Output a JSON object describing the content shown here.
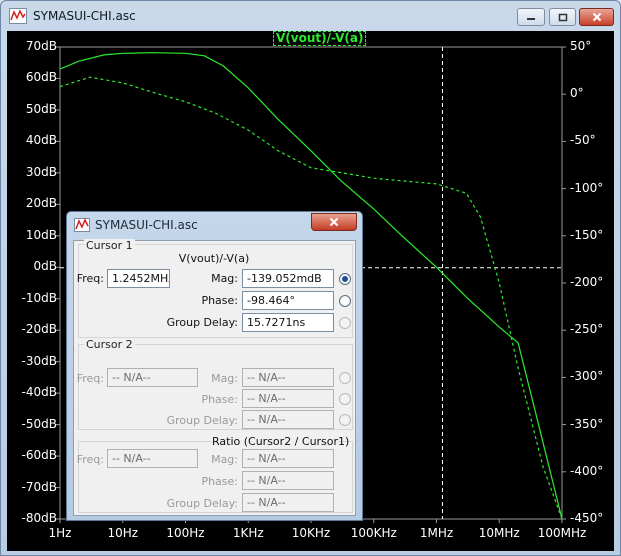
{
  "window": {
    "title": "SYMASUI-CHI.asc",
    "app_icon": "waveform-icon",
    "buttons": {
      "minimize": "minimize-icon",
      "maximize": "maximize-icon",
      "close": "close-icon"
    }
  },
  "plot": {
    "trace_name": "V(vout)/-V(a)",
    "background": "#000000",
    "trace_color": "#2eea2e",
    "grid_color": "#ffffff"
  },
  "chart_data": {
    "type": "line",
    "title": "V(vout)/-V(a)",
    "x_scale": "log",
    "xlim": [
      1,
      100000000
    ],
    "x_ticks": [
      "1Hz",
      "10Hz",
      "100Hz",
      "1KHz",
      "10KHz",
      "100KHz",
      "1MHz",
      "10MHz",
      "100MHz"
    ],
    "y_left": {
      "unit": "dB",
      "ylim": [
        -80,
        70
      ],
      "ticks": [
        "70dB",
        "60dB",
        "50dB",
        "40dB",
        "30dB",
        "20dB",
        "10dB",
        "0dB",
        "-10dB",
        "-20dB",
        "-30dB",
        "-40dB",
        "-50dB",
        "-60dB",
        "-70dB",
        "-80dB"
      ]
    },
    "y_right": {
      "unit": "°",
      "ylim": [
        -450,
        50
      ],
      "ticks": [
        "50°",
        "0°",
        "-50°",
        "-100°",
        "-150°",
        "-200°",
        "-250°",
        "-300°",
        "-350°",
        "-400°",
        "-450°"
      ]
    },
    "series": [
      {
        "style": "solid",
        "axis": "left",
        "x": [
          1,
          2,
          5,
          10,
          30,
          100,
          200,
          400,
          1000,
          3000,
          10000,
          30000,
          100000,
          300000,
          1000000,
          3000000,
          10000000,
          20000000,
          40000000,
          100000000
        ],
        "y": [
          63,
          65.5,
          67.5,
          68,
          68.2,
          68,
          67.2,
          64,
          57,
          47,
          37,
          27.5,
          18.5,
          9.5,
          0,
          -9.5,
          -19,
          -24,
          -48,
          -80
        ]
      },
      {
        "style": "dashed",
        "axis": "right",
        "x": [
          1,
          3,
          10,
          30,
          100,
          300,
          1000,
          3000,
          10000,
          30000,
          100000,
          300000,
          1000000,
          3000000,
          5000000,
          10000000,
          20000000,
          50000000,
          100000000
        ],
        "y": [
          8,
          18,
          12,
          2,
          -8,
          -20,
          -38,
          -60,
          -78,
          -83,
          -89,
          -92,
          -95,
          -105,
          -130,
          -200,
          -290,
          -395,
          -450
        ]
      }
    ],
    "cursor": {
      "x": 1245200,
      "y": -0.139
    }
  },
  "dialog": {
    "title": "SYMASUI-CHI.asc",
    "close_icon": "close-icon",
    "cursor1": {
      "group": "Cursor 1",
      "trace": "V(vout)/-V(a)",
      "freq_label": "Freq:",
      "freq": "1.2452MHz",
      "mag_label": "Mag:",
      "mag": "-139.052mdB",
      "phase_label": "Phase:",
      "phase": "-98.464°",
      "gd_label": "Group Delay:",
      "gd": "15.7271ns"
    },
    "cursor2": {
      "group": "Cursor 2",
      "freq_label": "Freq:",
      "freq": "-- N/A--",
      "mag_label": "Mag:",
      "mag": "-- N/A--",
      "phase_label": "Phase:",
      "phase": "-- N/A--",
      "gd_label": "Group Delay:",
      "gd": "-- N/A--"
    },
    "ratio": {
      "group": "Ratio (Cursor2 / Cursor1)",
      "freq_label": "Freq:",
      "freq": "-- N/A--",
      "mag_label": "Mag:",
      "mag": "-- N/A--",
      "phase_label": "Phase:",
      "phase": "-- N/A--",
      "gd_label": "Group Delay:",
      "gd": "-- N/A--"
    }
  }
}
